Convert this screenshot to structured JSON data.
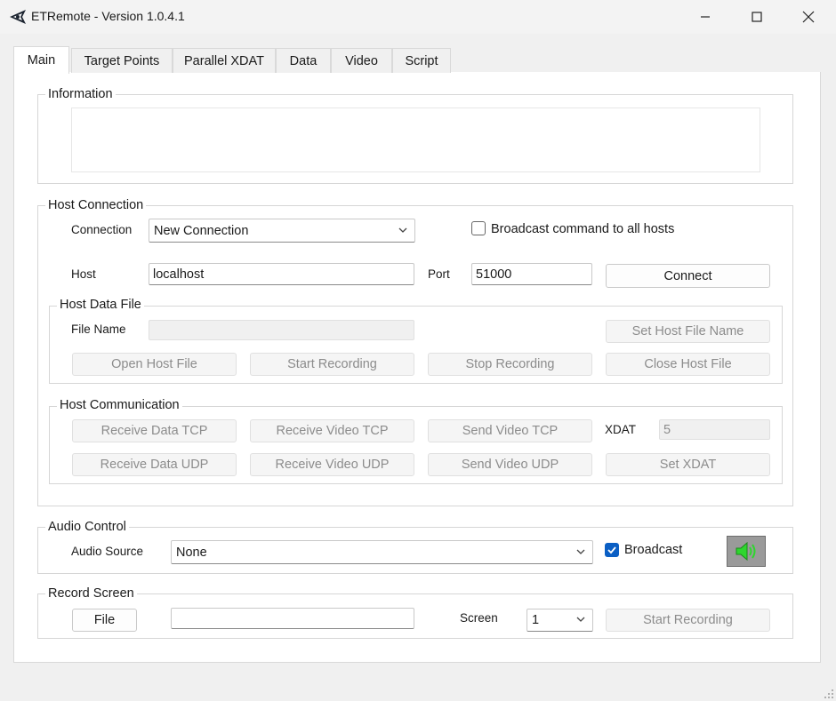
{
  "window": {
    "title": "ETRemote - Version 1.0.4.1"
  },
  "tabs": [
    {
      "label": "Main"
    },
    {
      "label": "Target Points"
    },
    {
      "label": "Parallel XDAT"
    },
    {
      "label": "Data"
    },
    {
      "label": "Video"
    },
    {
      "label": "Script"
    }
  ],
  "information": {
    "legend": "Information"
  },
  "host_connection": {
    "legend": "Host Connection",
    "connection_label": "Connection",
    "connection_value": "New Connection",
    "broadcast_label": "Broadcast command to all hosts",
    "broadcast_checked": false,
    "host_label": "Host",
    "host_value": "localhost",
    "port_label": "Port",
    "port_value": "51000",
    "connect_label": "Connect"
  },
  "host_data_file": {
    "legend": "Host Data File",
    "file_name_label": "File Name",
    "file_name_value": "",
    "set_host_file_name": "Set Host File Name",
    "open_host_file": "Open Host File",
    "start_recording": "Start Recording",
    "stop_recording": "Stop Recording",
    "close_host_file": "Close Host File"
  },
  "host_communication": {
    "legend": "Host Communication",
    "receive_data_tcp": "Receive Data TCP",
    "receive_video_tcp": "Receive Video TCP",
    "send_video_tcp": "Send Video TCP",
    "xdat_label": "XDAT",
    "xdat_value": "5",
    "receive_data_udp": "Receive Data UDP",
    "receive_video_udp": "Receive Video UDP",
    "send_video_udp": "Send Video UDP",
    "set_xdat": "Set XDAT"
  },
  "audio_control": {
    "legend": "Audio Control",
    "audio_source_label": "Audio Source",
    "audio_source_value": "None",
    "broadcast_label": "Broadcast",
    "broadcast_checked": true,
    "speaker_icon": "speaker-icon"
  },
  "record_screen": {
    "legend": "Record Screen",
    "file_button": "File",
    "file_path": "",
    "screen_label": "Screen",
    "screen_value": "1",
    "start_recording": "Start Recording"
  }
}
